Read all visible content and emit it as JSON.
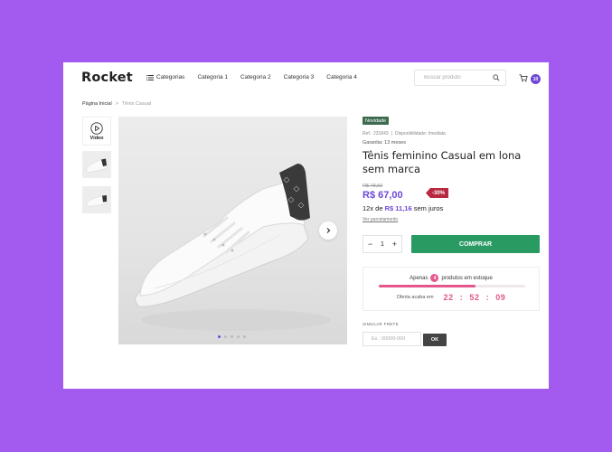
{
  "header": {
    "logo": "Rocket",
    "nav": [
      {
        "label": "Categorias",
        "icon": "menu-icon"
      },
      {
        "label": "Categoria 1"
      },
      {
        "label": "Categoria 2"
      },
      {
        "label": "Categoria 3"
      },
      {
        "label": "Categoria 4"
      }
    ],
    "search": {
      "placeholder": "Buscar produto",
      "icon": "search-icon"
    },
    "cart": {
      "icon": "cart-icon",
      "count": "10"
    }
  },
  "breadcrumb": {
    "home": "Página Inicial",
    "separator": ">",
    "current": "Tênis Casual"
  },
  "gallery": {
    "video_label": "Vídeo",
    "thumbnails": 2,
    "dots": 5,
    "active_dot": 0
  },
  "product": {
    "badge": "Novidade",
    "ref": "Ref.: 231843",
    "meta_sep": "|",
    "availability": "Disponibilidade: Imediata",
    "warranty": "Garantia: 13 meses",
    "title": "Tênis feminino Casual em lona sem marca",
    "old_price": "R$ 78,50",
    "price": "R$ 67,00",
    "discount": "-30%",
    "installments_prefix": "12x de",
    "installments_value": "R$ 11,16",
    "installments_suffix": "sem juros",
    "see_installments": "Ver parcelamento",
    "quantity": "1",
    "minus": "−",
    "plus": "+",
    "buy_label": "COMPRAR"
  },
  "stock": {
    "prefix": "Apenas",
    "count": "4",
    "suffix": "produtos em estoque",
    "level": 0.66,
    "offer_label": "Oferta acaba em",
    "hours": "22",
    "minutes": "52",
    "seconds": "09",
    "colon": ":"
  },
  "shipping": {
    "label": "SIMULAR FRETE",
    "placeholder": "Ex.: 00000-000",
    "ok_label": "OK"
  },
  "colors": {
    "background": "#a35bef",
    "accent": "#6f49d6",
    "buy": "#2a9a63",
    "badge": "#3c6b50",
    "discount": "#b8283f",
    "stock": "#e4568e"
  }
}
